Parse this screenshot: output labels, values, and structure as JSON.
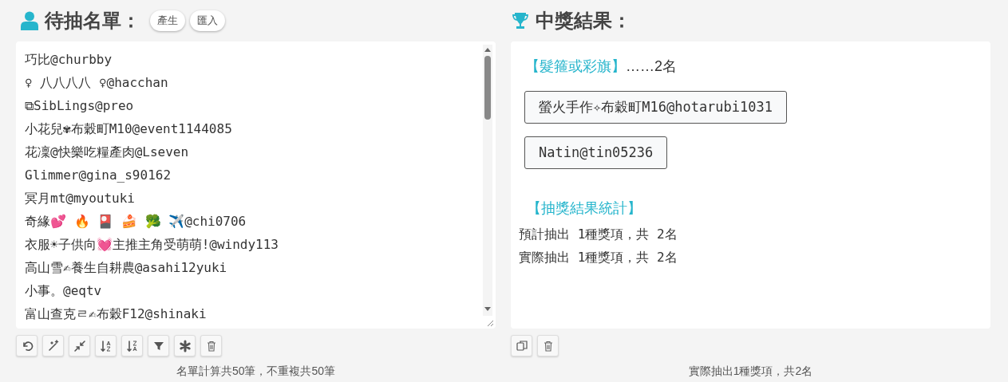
{
  "list_panel": {
    "title": "待抽名單：",
    "buttons": [
      "產生",
      "匯入"
    ],
    "entries": [
      "巧比@churbby",
      "♀ 八八八八 ♀@hacchan",
      "⧉SibLings@preo",
      "小花兒✾布穀町M10@event1144085",
      "花凜@快樂吃糧產肉@Lseven",
      "Glimmer@gina_s90162",
      "冥月mt@myoutuki",
      "奇緣💕 🔥 🎴 🍰 🥦 ✈️@chi0706",
      "衣服☀子供向💓主推主角受萌萌!@windy113",
      "高山雪✍養生自耕農@asahi12yuki",
      "小事。@eqtv",
      "富山查克ㄹ✍布穀F12@shinaki"
    ],
    "tools": [
      {
        "kind": "undo"
      },
      {
        "kind": "wand"
      },
      {
        "kind": "compress"
      },
      {
        "kind": "sort-asc"
      },
      {
        "kind": "sort-desc"
      },
      {
        "kind": "filter"
      },
      {
        "kind": "asterisk"
      },
      {
        "kind": "trash"
      }
    ],
    "summary": "名單計算共50筆，不重複共50筆"
  },
  "result_panel": {
    "title": "中獎結果：",
    "prize": {
      "name": "【髮箍或彩旗】",
      "count": "……2名",
      "winners": [
        "螢火手作✧布穀町M16@hotarubi1031",
        "Natin@tin05236"
      ]
    },
    "stats_title": "【抽獎結果統計】",
    "stats": [
      "預計抽出 1種獎項，共 2名",
      "實際抽出 1種獎項，共 2名"
    ],
    "tools": [
      {
        "kind": "copy"
      },
      {
        "kind": "trash"
      }
    ],
    "summary": "實際抽出1種獎項，共2名"
  }
}
